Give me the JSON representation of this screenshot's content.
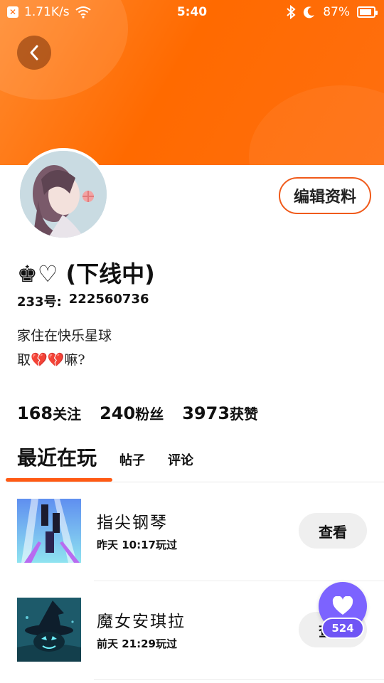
{
  "status_bar": {
    "net_speed": "1.71K/s",
    "time": "5:40",
    "battery": "87%",
    "battery_level": 0.87
  },
  "profile": {
    "nickname": "♚♡ (下线中)",
    "uid_label": "233号:",
    "uid_value": "222560736",
    "bio_line1": "家住在快乐星球",
    "bio_line2": "取💔💔嘛?",
    "edit_button": "编辑资料"
  },
  "stats": [
    {
      "value": "168",
      "label": "关注"
    },
    {
      "value": "240",
      "label": "粉丝"
    },
    {
      "value": "3973",
      "label": "获赞"
    }
  ],
  "tabs": [
    {
      "label": "最近在玩",
      "active": true
    },
    {
      "label": "帖子",
      "active": false
    },
    {
      "label": "评论",
      "active": false
    }
  ],
  "games": [
    {
      "name": "指尖钢琴",
      "played": "昨天 10:17玩过",
      "button": "查看",
      "icon": "piano-tiles-icon"
    },
    {
      "name": "魔女安琪拉",
      "played": "前天 21:29玩过",
      "button": "查看",
      "icon": "witch-hat-icon"
    }
  ],
  "like": {
    "count": "524",
    "icon": "heart-icon",
    "color": "#7c63ff"
  },
  "colors": {
    "accent": "#ff6a00",
    "tab_indicator": "#ff5a14",
    "edit_border": "#f05a1a"
  }
}
